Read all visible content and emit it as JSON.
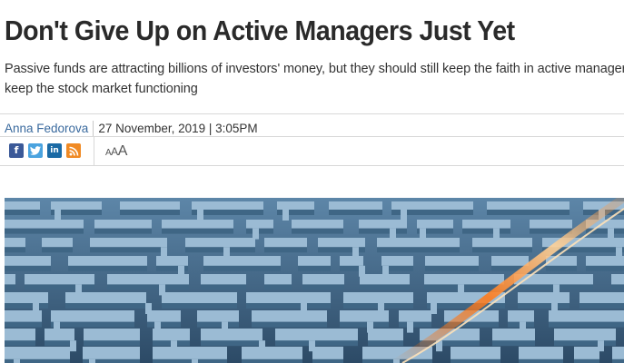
{
  "article": {
    "headline": "Don't Give Up on Active Managers Just Yet",
    "standfirst": "Passive funds are attracting billions of investors' money, but they should still keep the faith in active managers to keep the stock market functioning",
    "author": "Anna Fedorova",
    "date": "27 November, 2019 | 3:05PM"
  },
  "share": {
    "icons": [
      "facebook-icon",
      "twitter-icon",
      "linkedin-icon",
      "rss-icon"
    ]
  },
  "text_size": {
    "small": "A",
    "medium": "A",
    "large": "A"
  },
  "hero_image": {
    "subject": "maze",
    "colors": {
      "wall_top": "#9bbbd4",
      "wall_side": "#3f6685",
      "floor": "#1f3346",
      "streak": "#ff8a2a"
    }
  }
}
